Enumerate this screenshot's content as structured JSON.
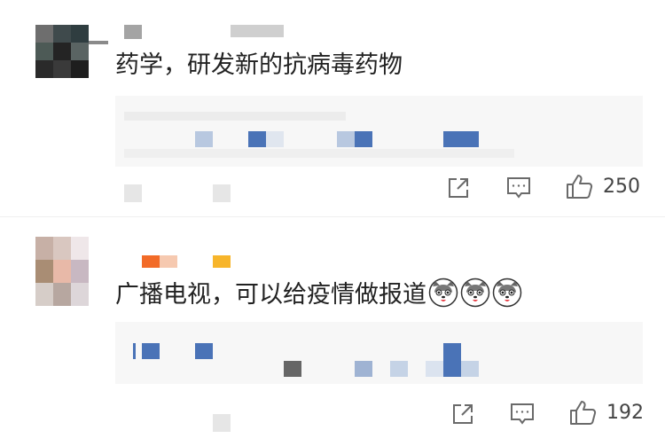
{
  "comments": [
    {
      "text": "药学，研发新的抗病毒药物",
      "like_count": "250",
      "colors": {
        "avatar": [
          "#6e6e6e",
          "#3f4a4c",
          "#2f3d40",
          "#4d5a56",
          "#242424",
          "#5a6463",
          "#2a2a2a",
          "#3a3a3a",
          "#1e1e1e"
        ]
      }
    },
    {
      "text": "广播电视，可以给疫情做报道",
      "emojis": [
        "husky-face-emoji",
        "husky-face-emoji",
        "husky-face-emoji"
      ],
      "like_count": "192",
      "colors": {
        "avatar": [
          "#c7b0a6",
          "#d9c7c0",
          "#efe7e9",
          "#a98d74",
          "#e8b9a8",
          "#c8b8c2",
          "#d6cdc8",
          "#b7a7a0",
          "#ddd6d9"
        ],
        "badges": [
          "#f26b28",
          "#f7b52b"
        ]
      }
    }
  ],
  "icons": [
    "share-icon",
    "comment-icon",
    "like-icon"
  ],
  "colors": {
    "text": "#222222",
    "reply_bg": "#f7f7f7",
    "link_blue": "#4a73b7",
    "link_blue_light": "#b8c8e0",
    "icon_gray": "#6a6a6a"
  }
}
